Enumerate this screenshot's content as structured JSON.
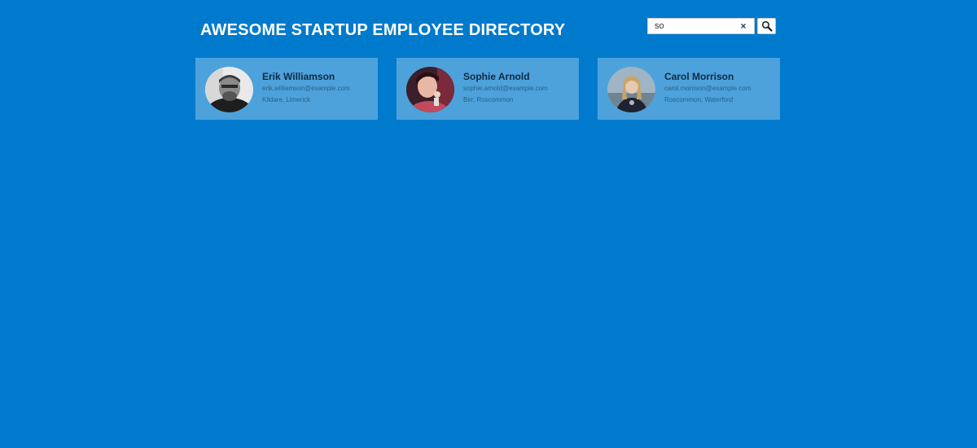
{
  "header": {
    "title": "AWESOME STARTUP EMPLOYEE DIRECTORY"
  },
  "search": {
    "value": "so",
    "clear_label": "×"
  },
  "employees": [
    {
      "name": "Erik Williamson",
      "email": "erik.williamson@example.com",
      "location": "Kildare, Limerick"
    },
    {
      "name": "Sophie Arnold",
      "email": "sophie.arnold@example.com",
      "location": "Birr, Roscommon"
    },
    {
      "name": "Carol Morrison",
      "email": "carol.morrison@example.com",
      "location": "Roscommon, Waterford"
    }
  ],
  "colors": {
    "background": "#007acc",
    "card": "rgba(255,255,255,0.30)",
    "title": "#ffffff"
  }
}
